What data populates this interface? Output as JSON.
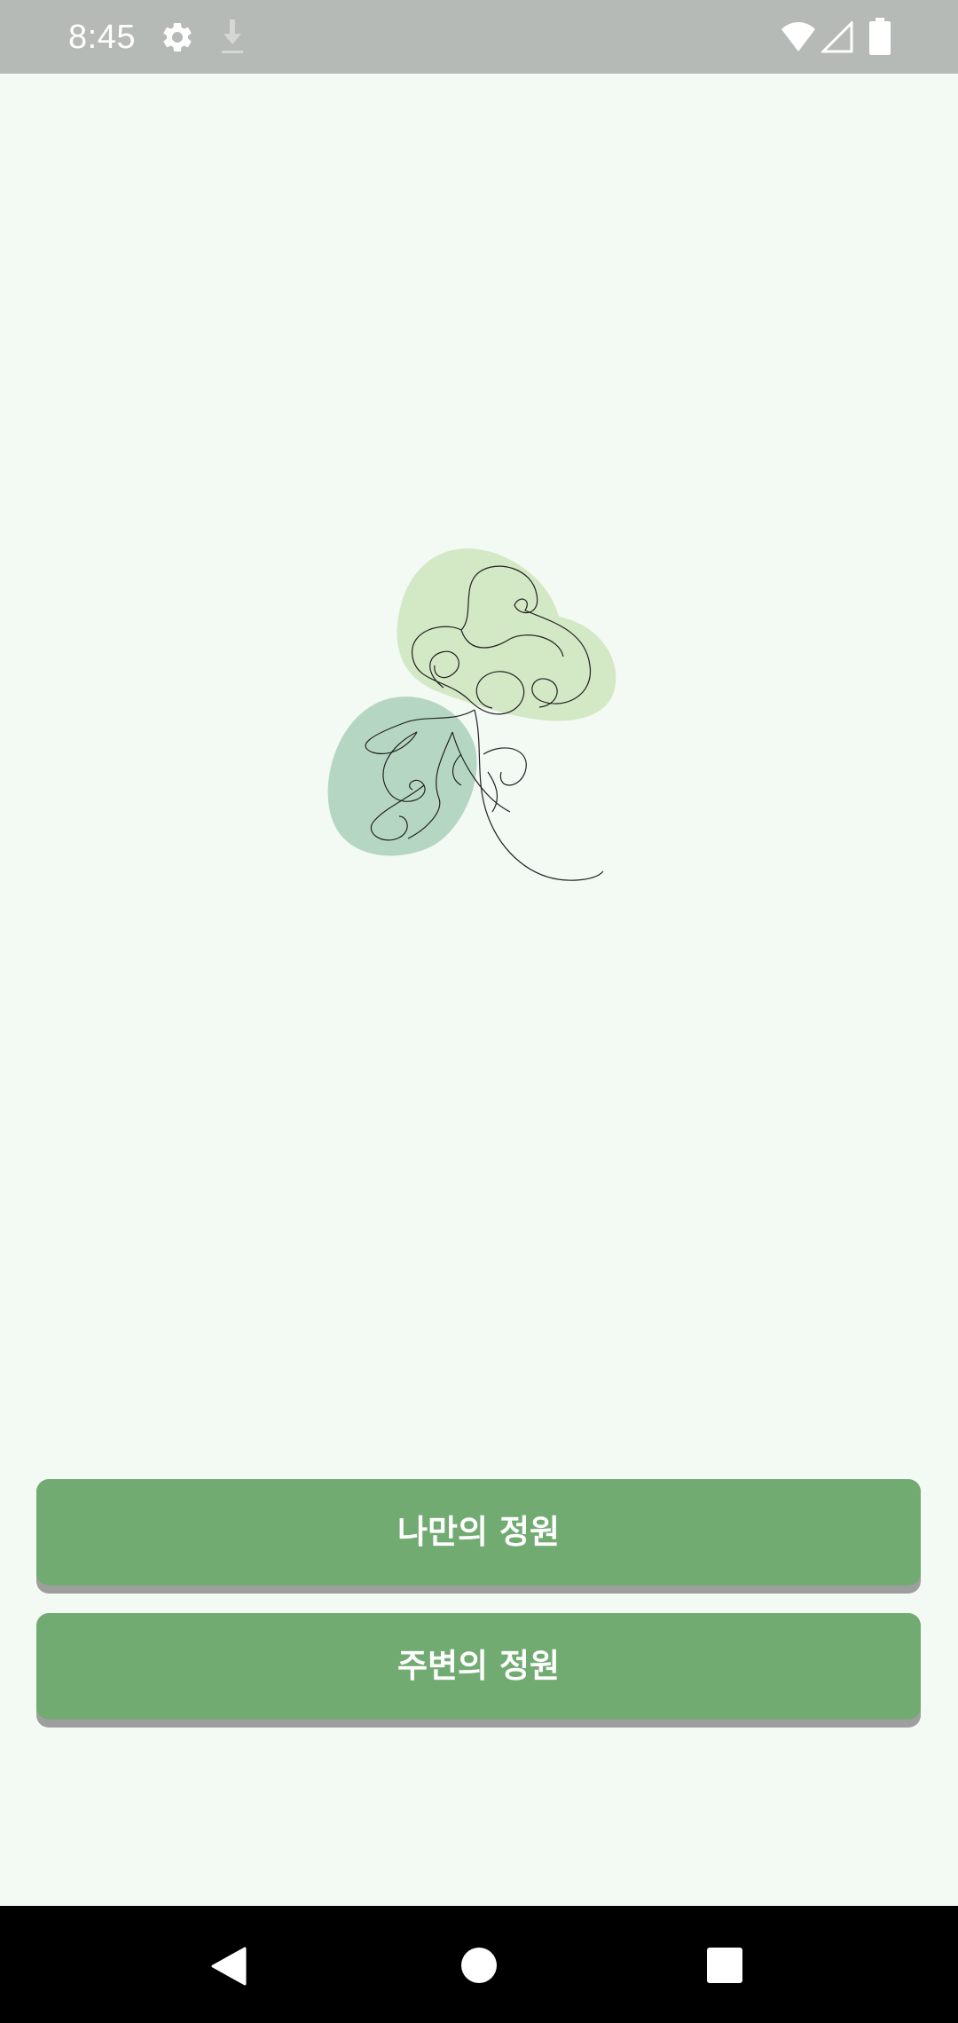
{
  "status_bar": {
    "time": "8:45",
    "icons": [
      "gear-icon",
      "download-icon",
      "wifi-icon",
      "signal-icon",
      "battery-icon"
    ]
  },
  "illustration": {
    "name": "leaf-illustration",
    "colors": {
      "light_leaf": "#d3e8c4",
      "dark_leaf": "#b6d6c4",
      "line": "#222222"
    }
  },
  "buttons": {
    "my_garden": "나만의 정원",
    "nearby_garden": "주변의 정원"
  },
  "colors": {
    "background": "#f3f9f3",
    "status_bar": "#b6bab7",
    "button": "#72ab72",
    "button_shadow": "#9e9e9e",
    "nav_bar": "#000000"
  },
  "nav_bar": {
    "icons": [
      "back-icon",
      "home-icon",
      "recents-icon"
    ]
  }
}
